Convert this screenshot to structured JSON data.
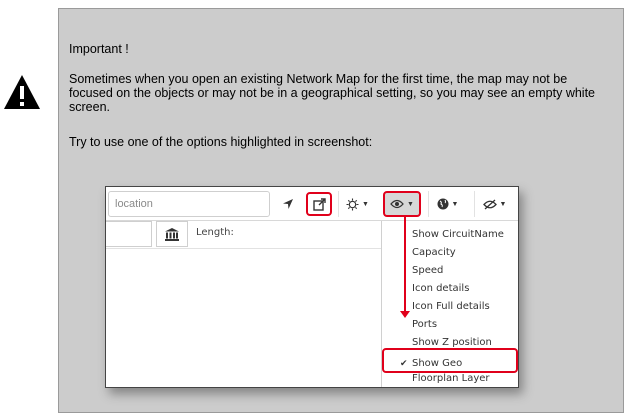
{
  "note": {
    "title": "Important !",
    "body": "Sometimes when you open an existing Network Map for the first time, the map may not be focused on the objects or may not be in a geographical setting, so you may see an empty white screen.",
    "hint": "Try to use one of the options highlighted in screenshot:"
  },
  "toolbar": {
    "location_placeholder": "location",
    "icons": [
      "navigate-icon",
      "open-external-icon",
      "sun-icon",
      "eye-icon",
      "globe-icon",
      "eye-slash-icon"
    ]
  },
  "secondary": {
    "length_label": "Length:",
    "icon": "bank-icon"
  },
  "menu": {
    "items": [
      "Show CircuitName",
      "Capacity",
      "Speed",
      "Icon details",
      "Icon Full details",
      "Ports",
      "Show Z position",
      "Show Geo",
      "Floorplan Layer"
    ],
    "checked": "Show Geo",
    "check_glyph": "✔"
  },
  "colors": {
    "highlight": "#e0001b",
    "note_background": "#cccccc"
  }
}
